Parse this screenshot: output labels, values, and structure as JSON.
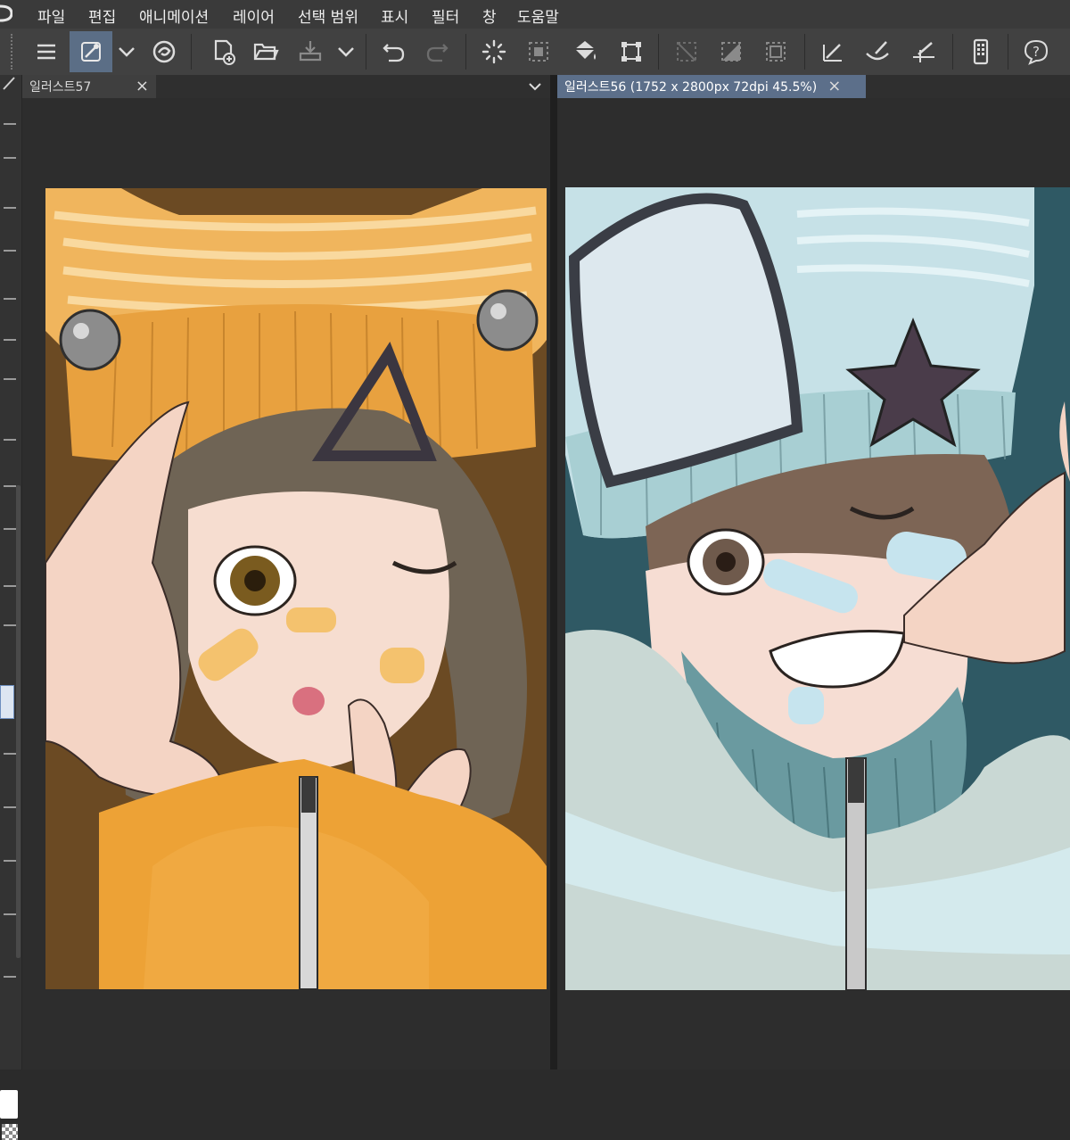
{
  "app": {
    "menu": [
      {
        "label": "파일",
        "id": "file"
      },
      {
        "label": "편집",
        "id": "edit"
      },
      {
        "label": "애니메이션",
        "id": "animation"
      },
      {
        "label": "레이어",
        "id": "layer"
      },
      {
        "label": "선택 범위",
        "id": "selection"
      },
      {
        "label": "표시",
        "id": "view"
      },
      {
        "label": "필터",
        "id": "filter"
      },
      {
        "label": "창",
        "id": "window"
      },
      {
        "label": "도움말",
        "id": "help"
      }
    ]
  },
  "toolbar": {
    "buttons": [
      {
        "name": "menu-icon"
      },
      {
        "name": "eyedropper-pen-icon",
        "active": true
      },
      {
        "name": "chevron-down-icon"
      },
      {
        "name": "swirl-logo-icon"
      },
      {
        "name": "new-file-icon"
      },
      {
        "name": "open-folder-icon"
      },
      {
        "name": "save-icon"
      },
      {
        "name": "chevron-down-icon"
      },
      {
        "name": "undo-icon"
      },
      {
        "name": "redo-icon"
      },
      {
        "name": "loading-spinner-icon"
      },
      {
        "name": "selection-dotted-icon"
      },
      {
        "name": "fill-bucket-icon"
      },
      {
        "name": "transform-icon"
      },
      {
        "name": "clear-selection-icon"
      },
      {
        "name": "invert-selection-icon"
      },
      {
        "name": "show-selection-icon"
      },
      {
        "name": "ruler-pen-icon"
      },
      {
        "name": "brush-icon"
      },
      {
        "name": "pencil-line-icon"
      },
      {
        "name": "smartphone-icon"
      },
      {
        "name": "help-icon"
      }
    ]
  },
  "documents": {
    "left_tab": {
      "title": "일러스트57",
      "close": "×"
    },
    "right_tab": {
      "title": "일러스트56 (1752 x 2800px 72dpi 45.5%)",
      "close": "×"
    },
    "dropdown_icon": "chevron-down-icon"
  },
  "colors": {
    "menubar": "#3a3a3a",
    "toolbar": "#414141",
    "active_tab": "#5c6f8a",
    "left_bg": "#6b4a23",
    "right_bg": "#2f5964"
  }
}
